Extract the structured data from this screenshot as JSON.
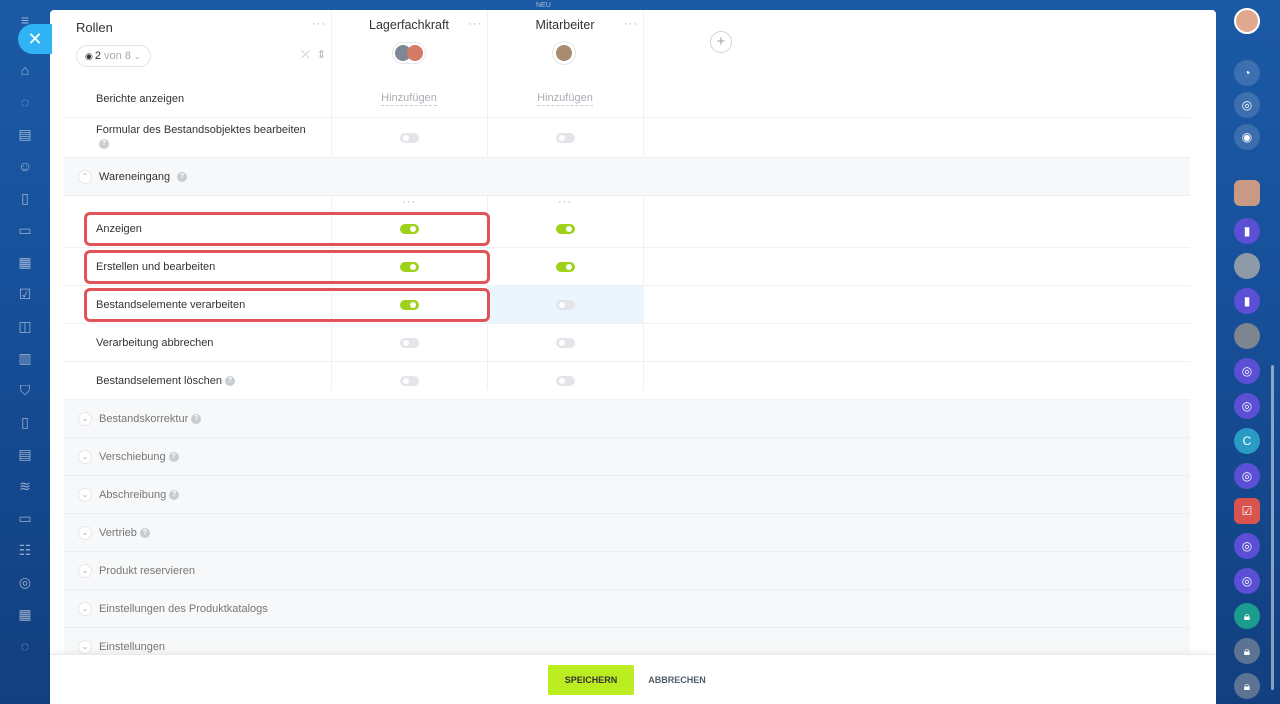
{
  "window": {
    "top_label": "NEU"
  },
  "header": {
    "title": "Rollen",
    "filter_count": "2",
    "filter_text": "von 8",
    "columns": [
      {
        "name": "Lagerfachkraft"
      },
      {
        "name": "Mitarbeiter"
      }
    ]
  },
  "rows_before": [
    {
      "label": "Berichte anzeigen",
      "values": [
        "Hinzufügen",
        "Hinzufügen"
      ]
    },
    {
      "label": "Formular des Bestandsobjektes bearbeiten",
      "help": true,
      "values": [
        "off",
        "off"
      ]
    }
  ],
  "section_open": {
    "title": "Wareneingang",
    "rows": [
      {
        "label": "Anzeigen",
        "values": [
          "on",
          "on"
        ],
        "highlight": true
      },
      {
        "label": "Erstellen und bearbeiten",
        "values": [
          "on",
          "on"
        ],
        "highlight": true
      },
      {
        "label": "Bestandselemente verarbeiten",
        "values": [
          "on",
          "off"
        ],
        "highlight": true
      },
      {
        "label": "Verarbeitung abbrechen",
        "values": [
          "off",
          "off"
        ]
      },
      {
        "label": "Bestandselement löschen",
        "help": true,
        "values": [
          "off",
          "off"
        ]
      }
    ]
  },
  "sections_collapsed": [
    {
      "title": "Bestandskorrektur",
      "help": true
    },
    {
      "title": "Verschiebung",
      "help": true
    },
    {
      "title": "Abschreibung",
      "help": true
    },
    {
      "title": "Vertrieb",
      "help": true
    },
    {
      "title": "Produkt reservieren",
      "help": false
    },
    {
      "title": "Einstellungen des Produktkatalogs",
      "help": false
    },
    {
      "title": "Einstellungen",
      "help": false
    }
  ],
  "footer": {
    "save_label": "SPEICHERN",
    "cancel_label": "ABBRECHEN"
  },
  "right_rail": {
    "letter_avatar": "C"
  },
  "colors": {
    "accent": "#bbed21",
    "toggle_on": "#9dd11a",
    "highlight": "#e0535a",
    "close": "#2fb3f5"
  }
}
